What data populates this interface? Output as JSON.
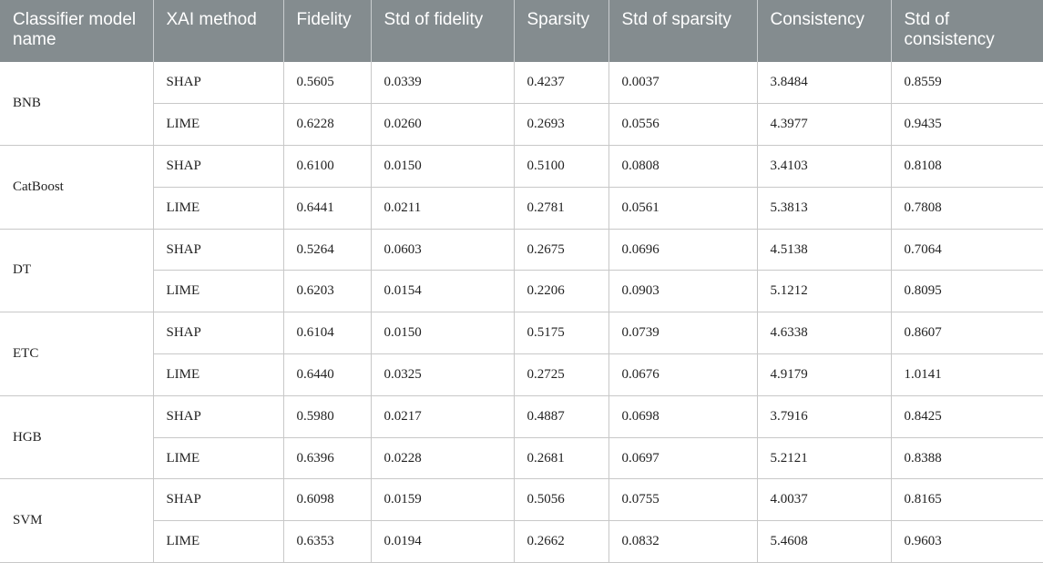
{
  "headers": [
    "Classifier model name",
    "XAI method",
    "Fidelity",
    "Std of fidelity",
    "Sparsity",
    "Std of sparsity",
    "Consistency",
    "Std of consistency"
  ],
  "groups": [
    {
      "model": "BNB",
      "rows": [
        {
          "method": "SHAP",
          "fidelity": "0.5605",
          "std_fidelity": "0.0339",
          "sparsity": "0.4237",
          "std_sparsity": "0.0037",
          "consistency": "3.8484",
          "std_consistency": "0.8559"
        },
        {
          "method": "LIME",
          "fidelity": "0.6228",
          "std_fidelity": "0.0260",
          "sparsity": "0.2693",
          "std_sparsity": "0.0556",
          "consistency": "4.3977",
          "std_consistency": "0.9435"
        }
      ]
    },
    {
      "model": "CatBoost",
      "rows": [
        {
          "method": "SHAP",
          "fidelity": "0.6100",
          "std_fidelity": "0.0150",
          "sparsity": "0.5100",
          "std_sparsity": "0.0808",
          "consistency": "3.4103",
          "std_consistency": "0.8108"
        },
        {
          "method": "LIME",
          "fidelity": "0.6441",
          "std_fidelity": "0.0211",
          "sparsity": "0.2781",
          "std_sparsity": "0.0561",
          "consistency": "5.3813",
          "std_consistency": "0.7808"
        }
      ]
    },
    {
      "model": "DT",
      "rows": [
        {
          "method": "SHAP",
          "fidelity": "0.5264",
          "std_fidelity": "0.0603",
          "sparsity": "0.2675",
          "std_sparsity": "0.0696",
          "consistency": "4.5138",
          "std_consistency": "0.7064"
        },
        {
          "method": "LIME",
          "fidelity": "0.6203",
          "std_fidelity": "0.0154",
          "sparsity": "0.2206",
          "std_sparsity": "0.0903",
          "consistency": "5.1212",
          "std_consistency": "0.8095"
        }
      ]
    },
    {
      "model": "ETC",
      "rows": [
        {
          "method": "SHAP",
          "fidelity": "0.6104",
          "std_fidelity": "0.0150",
          "sparsity": "0.5175",
          "std_sparsity": "0.0739",
          "consistency": "4.6338",
          "std_consistency": "0.8607"
        },
        {
          "method": "LIME",
          "fidelity": "0.6440",
          "std_fidelity": "0.0325",
          "sparsity": "0.2725",
          "std_sparsity": "0.0676",
          "consistency": "4.9179",
          "std_consistency": "1.0141"
        }
      ]
    },
    {
      "model": "HGB",
      "rows": [
        {
          "method": "SHAP",
          "fidelity": "0.5980",
          "std_fidelity": "0.0217",
          "sparsity": "0.4887",
          "std_sparsity": "0.0698",
          "consistency": "3.7916",
          "std_consistency": "0.8425"
        },
        {
          "method": "LIME",
          "fidelity": "0.6396",
          "std_fidelity": "0.0228",
          "sparsity": "0.2681",
          "std_sparsity": "0.0697",
          "consistency": "5.2121",
          "std_consistency": "0.8388"
        }
      ]
    },
    {
      "model": "SVM",
      "rows": [
        {
          "method": "SHAP",
          "fidelity": "0.6098",
          "std_fidelity": "0.0159",
          "sparsity": "0.5056",
          "std_sparsity": "0.0755",
          "consistency": "4.0037",
          "std_consistency": "0.8165"
        },
        {
          "method": "LIME",
          "fidelity": "0.6353",
          "std_fidelity": "0.0194",
          "sparsity": "0.2662",
          "std_sparsity": "0.0832",
          "consistency": "5.4608",
          "std_consistency": "0.9603"
        }
      ]
    }
  ]
}
